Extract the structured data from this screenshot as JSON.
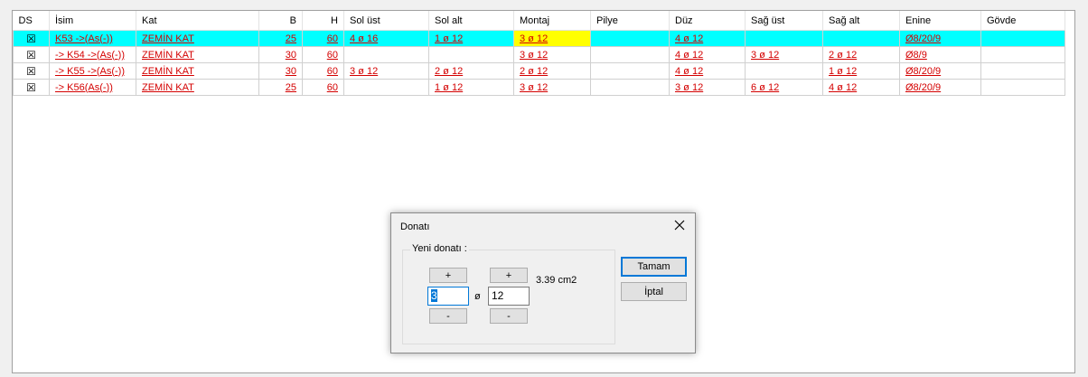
{
  "grid": {
    "columns": [
      {
        "key": "ds",
        "label": "DS",
        "width": 40,
        "align": "left"
      },
      {
        "key": "isim",
        "label": "İsim",
        "width": 96,
        "align": "left"
      },
      {
        "key": "kat",
        "label": "Kat",
        "width": 136,
        "align": "left"
      },
      {
        "key": "b",
        "label": "B",
        "width": 48,
        "align": "right"
      },
      {
        "key": "h",
        "label": "H",
        "width": 46,
        "align": "right"
      },
      {
        "key": "sol_ust",
        "label": "Sol üst",
        "width": 94,
        "align": "left"
      },
      {
        "key": "sol_alt",
        "label": "Sol alt",
        "width": 94,
        "align": "left"
      },
      {
        "key": "montaj",
        "label": "Montaj",
        "width": 85,
        "align": "left"
      },
      {
        "key": "pilye",
        "label": "Pilye",
        "width": 87,
        "align": "left"
      },
      {
        "key": "duz",
        "label": "Düz",
        "width": 84,
        "align": "left"
      },
      {
        "key": "sag_ust",
        "label": "Sağ üst",
        "width": 86,
        "align": "left"
      },
      {
        "key": "sag_alt",
        "label": "Sağ alt",
        "width": 85,
        "align": "left"
      },
      {
        "key": "enine",
        "label": "Enine",
        "width": 90,
        "align": "left"
      },
      {
        "key": "govde",
        "label": "Gövde",
        "width": 93,
        "align": "left"
      }
    ],
    "check_glyph": "☒",
    "rows": [
      {
        "selected": true,
        "ds": "☒",
        "isim": "K53 ->(As(-))",
        "kat": "ZEMİN KAT",
        "b": "25",
        "h": "60",
        "sol_ust": "4 ø 16",
        "sol_alt": "1 ø 12",
        "montaj": "3 ø 12",
        "pilye": "",
        "duz": "4 ø 12",
        "sag_ust": "",
        "sag_alt": "",
        "enine": "Ø8/20/9",
        "govde": ""
      },
      {
        "selected": false,
        "ds": "☒",
        "isim": "-> K54 ->(As(-))",
        "kat": "ZEMİN KAT",
        "b": "30",
        "h": "60",
        "sol_ust": "",
        "sol_alt": "",
        "montaj": "3 ø 12",
        "pilye": "",
        "duz": "4 ø 12",
        "sag_ust": "3 ø 12",
        "sag_alt": "2 ø 12",
        "enine": "Ø8/9",
        "govde": ""
      },
      {
        "selected": false,
        "ds": "☒",
        "isim": "-> K55 ->(As(-))",
        "kat": "ZEMİN KAT",
        "b": "30",
        "h": "60",
        "sol_ust": "3 ø 12",
        "sol_alt": "2 ø 12",
        "montaj": "2 ø 12",
        "pilye": "",
        "duz": "4 ø 12",
        "sag_ust": "",
        "sag_alt": "1 ø 12",
        "enine": "Ø8/20/9",
        "govde": ""
      },
      {
        "selected": false,
        "ds": "☒",
        "isim": "-> K56(As(-))",
        "kat": "ZEMİN KAT",
        "b": "25",
        "h": "60",
        "sol_ust": "",
        "sol_alt": "1 ø 12",
        "montaj": "3 ø 12",
        "pilye": "",
        "duz": "3 ø 12",
        "sag_ust": "6 ø 12",
        "sag_alt": "4 ø 12",
        "enine": "Ø8/20/9",
        "govde": ""
      }
    ]
  },
  "dialog": {
    "title": "Donatı",
    "group_label": "Yeni donatı :",
    "plus_label": "+",
    "minus_label": "-",
    "count_value": "3",
    "phi_symbol": "ø",
    "diameter_value": "12",
    "area_text": "3.39 cm2",
    "ok_label": "Tamam",
    "cancel_label": "İptal"
  },
  "colors": {
    "selected_row": "#00ffff",
    "highlight_cell": "#ffff00",
    "link_red": "#d40000",
    "focus_blue": "#0078d7"
  }
}
